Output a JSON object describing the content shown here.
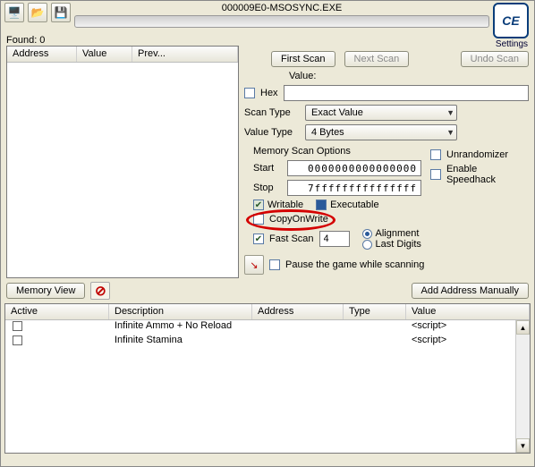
{
  "title": "000009E0-MSOSYNC.EXE",
  "settings_label": "Settings",
  "found_label": "Found: 0",
  "columns": {
    "address": "Address",
    "value": "Value",
    "prev": "Prev..."
  },
  "buttons": {
    "first_scan": "First Scan",
    "next_scan": "Next Scan",
    "undo_scan": "Undo Scan",
    "memory_view": "Memory View",
    "add_manual": "Add Address Manually"
  },
  "labels": {
    "value": "Value:",
    "hex": "Hex",
    "scan_type": "Scan Type",
    "value_type": "Value Type",
    "mem_opts": "Memory Scan Options",
    "start": "Start",
    "stop": "Stop",
    "writable": "Writable",
    "executable": "Executable",
    "copyonwrite": "CopyOnWrite",
    "fastscan": "Fast Scan",
    "alignment": "Alignment",
    "lastdigits": "Last Digits",
    "pause": "Pause the game while scanning",
    "unrandomizer": "Unrandomizer",
    "speedhack": "Enable Speedhack"
  },
  "values": {
    "scan_type": "Exact Value",
    "value_type": "4 Bytes",
    "start": "0000000000000000",
    "stop": "7fffffffffffffff",
    "fastscan": "4"
  },
  "table_headers": {
    "active": "Active",
    "description": "Description",
    "address": "Address",
    "type": "Type",
    "value": "Value"
  },
  "table_rows": [
    {
      "description": "Infinite Ammo + No Reload",
      "address": "",
      "type": "",
      "value": "<script>"
    },
    {
      "description": "Infinite Stamina",
      "address": "",
      "type": "",
      "value": "<script>"
    }
  ]
}
